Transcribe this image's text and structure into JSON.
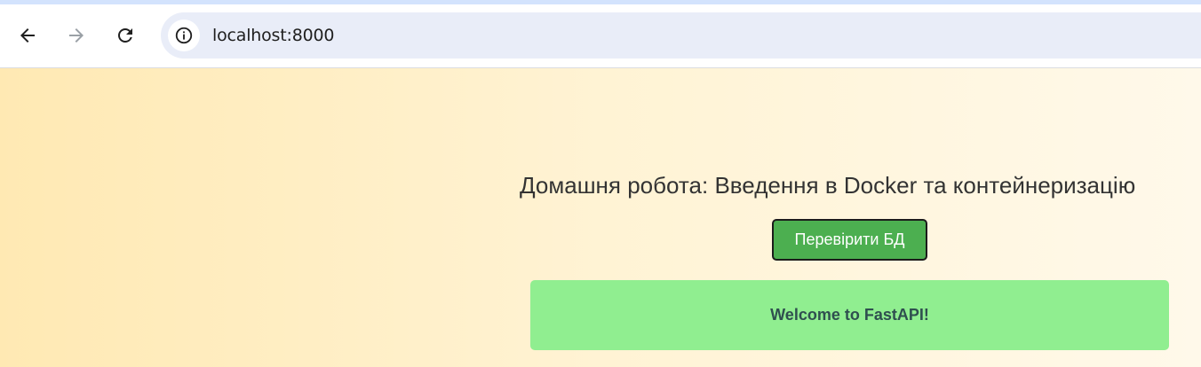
{
  "browser": {
    "url": "localhost:8000",
    "icons": {
      "back": "arrow-back-icon",
      "forward": "arrow-forward-icon",
      "reload": "reload-icon",
      "site_info": "info-icon"
    }
  },
  "page": {
    "heading": "Домашня робота: Введення в Docker та контейнеризацію",
    "button_label": "Перевірити БД",
    "message": "Welcome to FastAPI!"
  },
  "colors": {
    "button_bg": "#4caf50",
    "message_bg": "#90ee90",
    "page_gradient_start": "#ffe9b3",
    "page_gradient_end": "#fff9ea"
  }
}
